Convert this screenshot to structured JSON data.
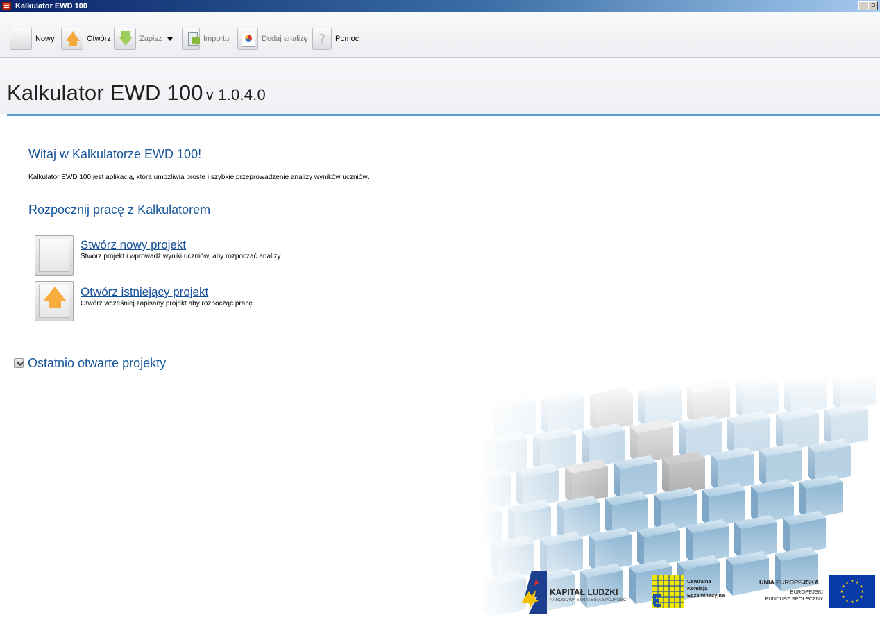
{
  "window": {
    "title": "Kalkulator EWD 100"
  },
  "toolbar": {
    "new_label": "Nowy",
    "open_label": "Otwórz",
    "save_label": "Zapisz",
    "import_label": "Importuj",
    "add_analysis_label": "Dodaj analizę",
    "help_label": "Pomoc"
  },
  "header": {
    "app_name": "Kalkulator EWD 100",
    "version": "v 1.0.4.0"
  },
  "welcome": {
    "heading": "Witaj w Kalkulatorze EWD 100!",
    "description": "Kalkulator EWD 100 jest aplikacją, która umożliwia proste i szybkie przeprowadzenie analizy wyników uczniów."
  },
  "start": {
    "heading": "Rozpocznij pracę z Kalkulatorem",
    "actions": [
      {
        "label": "Stwórz nowy projekt",
        "description": "Stwórz projekt i wprowadź wyniki uczniów, aby rozpocząć analizy."
      },
      {
        "label": "Otwórz istniejący projekt",
        "description": "Otwórz wcześniej zapisany projekt aby rozpocząć pracę"
      }
    ]
  },
  "recent": {
    "heading": "Ostatnio otwarte projekty"
  },
  "logos": {
    "kapital_ludzki": "KAPITAŁ LUDZKI",
    "kapital_ludzki_sub": "NARODOWA STRATEGIA SPÓJNOŚCI",
    "cke": [
      "Centralna",
      "Komisja",
      "Egzaminacyjna"
    ],
    "ue_title": "UNIA EUROPEJSKA",
    "ue_sub1": "EUROPEJSKI",
    "ue_sub2": "FUNDUSZ SPOŁECZNY"
  },
  "colors": {
    "heading_blue": "#17569c",
    "accent_line": "#5aa0d8",
    "titlebar": "#0a246a"
  }
}
